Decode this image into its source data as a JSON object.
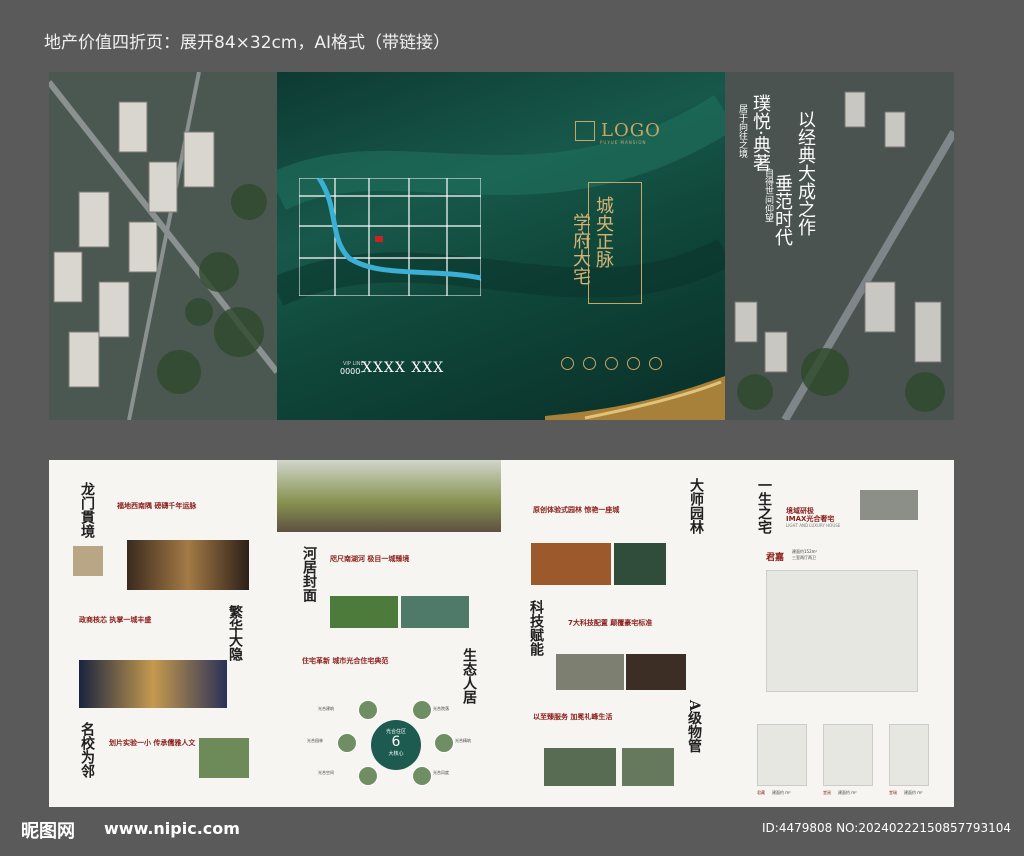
{
  "header": {
    "title": "地产价值四折页：展开84×32cm，AI格式（带链接）"
  },
  "cover": {
    "logo": "LOGO",
    "logo_sub": "PUYUE MANSION",
    "vertical_title_1": "城央正脉",
    "vertical_title_2": "学府大宅",
    "vip_label": "VIP LINE",
    "phone_prefix": "0000-",
    "phone": "XXXX XXX",
    "address": "",
    "right_title_1": "以经典大成之作",
    "right_title_2": "垂范时代",
    "right_title_3": "璞悦·典著",
    "right_small_1": "居于向往之境",
    "right_small_2": "自得世间仰望"
  },
  "inside": {
    "s1": {
      "title": "龙门貫境",
      "heading": "福地西南隅 磅礴千年运脉"
    },
    "s2": {
      "heading": "政商核芯 执掌一城丰盛",
      "title": "繁华大隐"
    },
    "s3": {
      "title": "名校为邻",
      "heading": "划片实验一小 传承儒雅人文"
    },
    "s4": {
      "title": "河居封面",
      "heading": "咫尺南湖河 极目一城臻境"
    },
    "s5": {
      "heading": "住宅革新 城市光合住宅典范",
      "title": "生态人居",
      "center_label": "光合住区",
      "center_number": "6",
      "center_sub": "大核心",
      "nodes": [
        "光合建筑",
        "光合园林",
        "光合空间",
        "光合院落",
        "光合精筑",
        "光合风度"
      ]
    },
    "s6": {
      "heading": "原创体验式园林 惊艳一座城",
      "title": "大师园林"
    },
    "s7": {
      "title": "科技赋能",
      "heading": "7大科技配置 颠覆豪宅标准"
    },
    "s8": {
      "heading": "以至臻服务 加冕礼峰生活",
      "title": "A级物管"
    },
    "s9": {
      "title": "一生之宅",
      "heading": "境域研极",
      "heading2": "IMAX光合奢宅",
      "sub": "LIGHT AND LUXURY HOUSE",
      "plan_name": "君嘉",
      "plan_area": "建面约152m²",
      "plan_layout": "三室两厅两卫",
      "small_plans": [
        {
          "name": "君藏",
          "note": "建面约 m²"
        },
        {
          "name": "堂阅",
          "note": "建面约 m²"
        },
        {
          "name": "堂瑞",
          "note": "建面约 m²"
        }
      ]
    }
  },
  "footer": {
    "logo": "昵图网",
    "url": "www.nipic.com",
    "id": "ID:4479808 NO:20240222150857793104"
  }
}
